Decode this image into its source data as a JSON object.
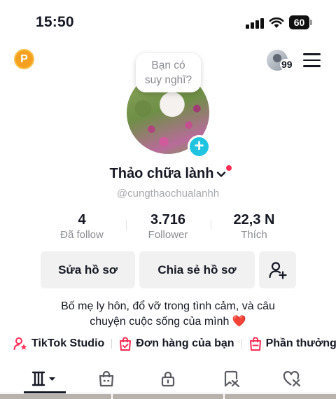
{
  "status_bar": {
    "time": "15:50",
    "battery": "60"
  },
  "header": {
    "coin_label": "P",
    "notification_count": "99"
  },
  "profile": {
    "thought_bubble": "Bạn có suy nghĩ?",
    "display_name": "Thảo chữa lành",
    "username": "@cungthaochualanhh",
    "stats": [
      {
        "value": "4",
        "label": "Đã follow"
      },
      {
        "value": "3.716",
        "label": "Follower"
      },
      {
        "value": "22,3 N",
        "label": "Thích"
      }
    ],
    "buttons": {
      "edit": "Sửa hồ sơ",
      "share": "Chia sẻ hồ sơ"
    },
    "bio_line1": "Bố mẹ ly hôn, đổ vỡ trong tình cảm, và câu",
    "bio_line2": "chuyện cuộc sống của mình ❤️"
  },
  "links": {
    "studio": "TikTok Studio",
    "orders": "Đơn hàng của bạn",
    "rewards": "Phần thưởng"
  },
  "tabs": [
    "videos",
    "shop",
    "private",
    "reposts",
    "liked"
  ],
  "colors": {
    "accent_red": "#fe2c55",
    "add_button": "#21c4e0",
    "coin": "#f5a11f"
  }
}
